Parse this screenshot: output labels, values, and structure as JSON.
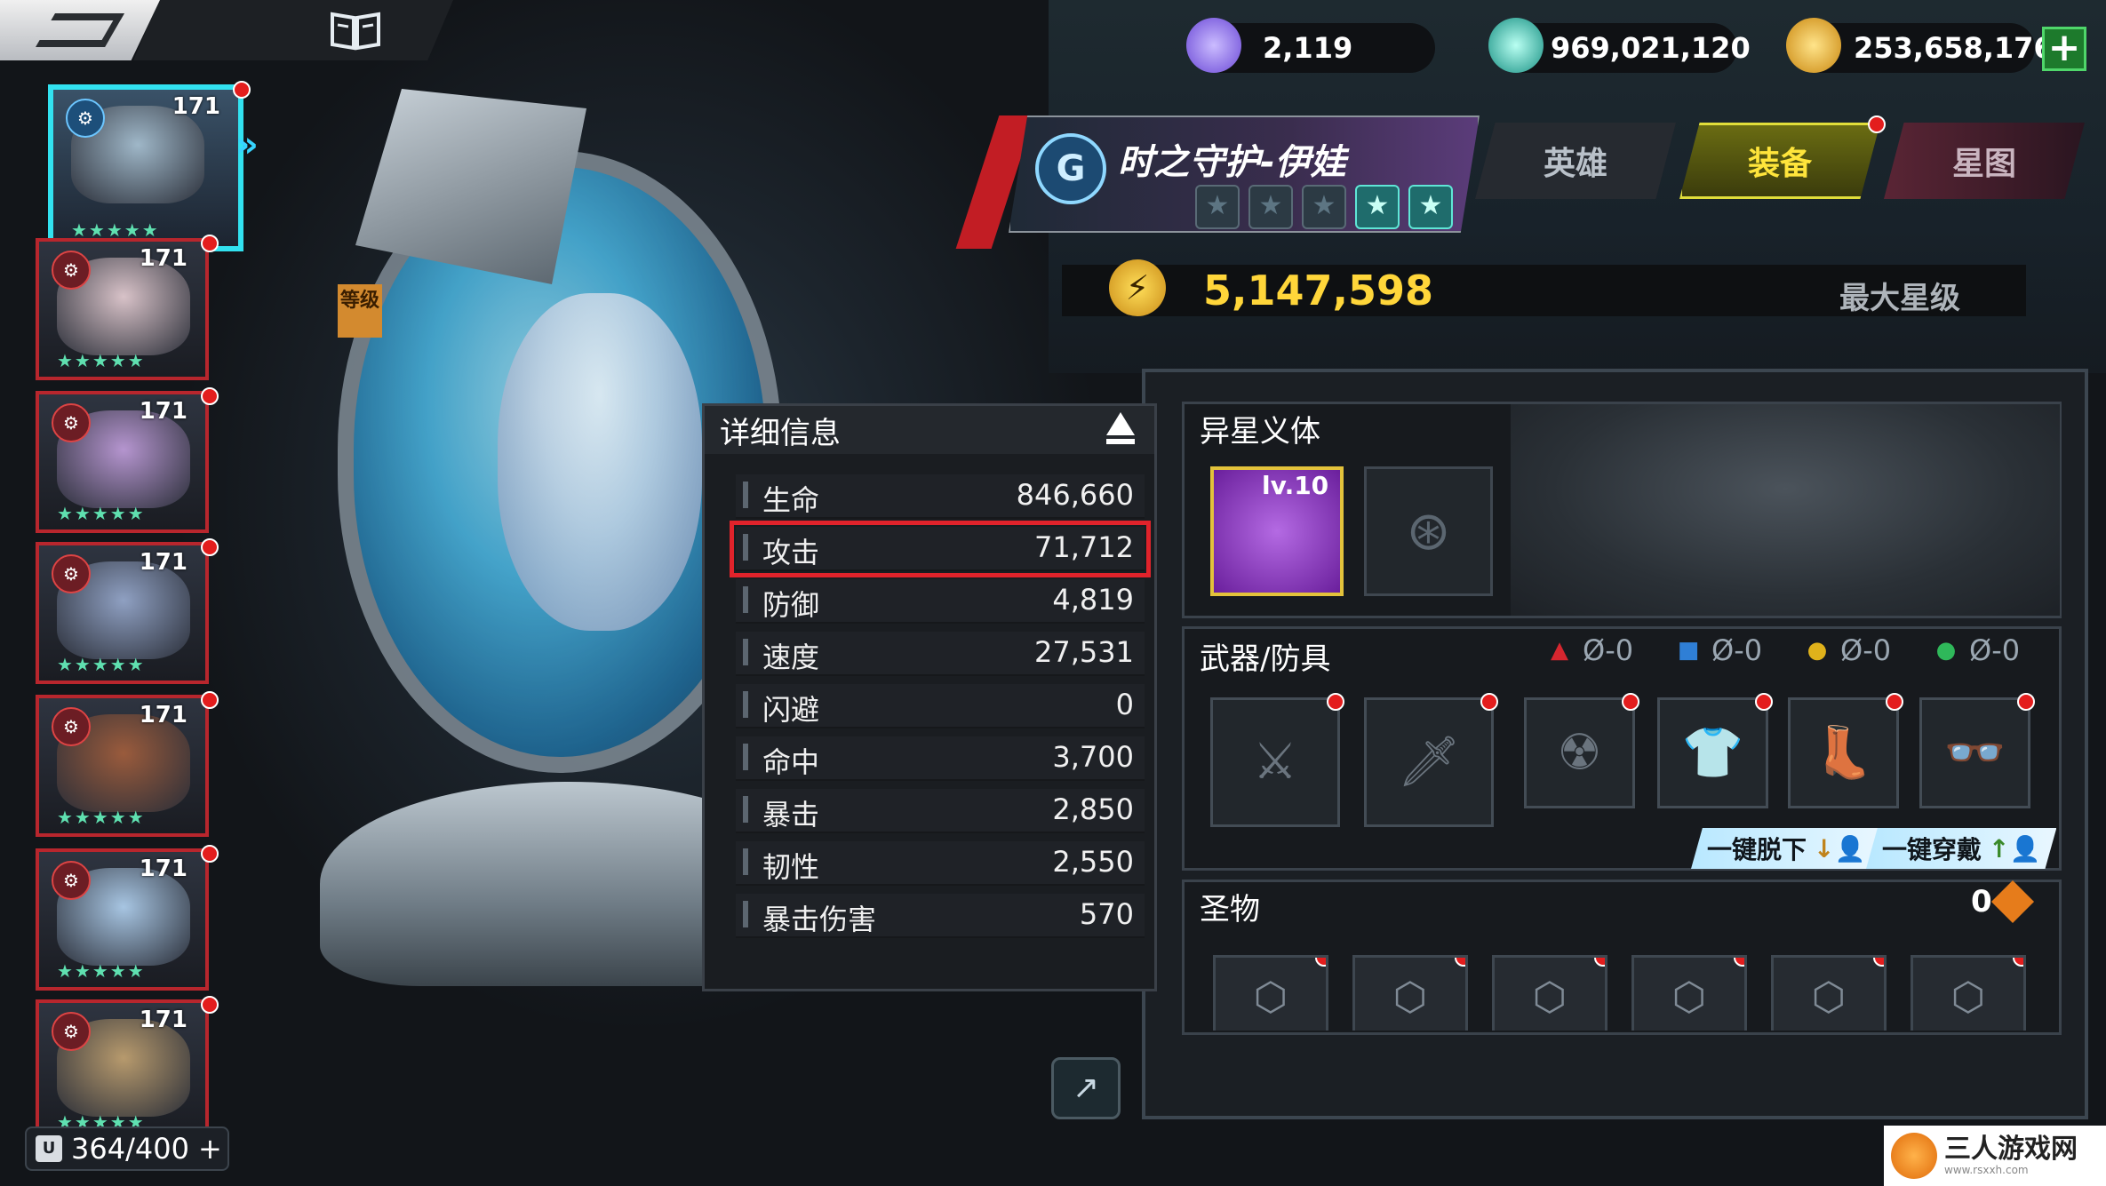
{
  "currency": [
    {
      "name": "gem",
      "value": "2,119",
      "color": "#7a5be0"
    },
    {
      "name": "credit",
      "value": "969,021,120",
      "color": "#1fb6a6"
    },
    {
      "name": "gold",
      "value": "253,658,176",
      "color": "#e3a21b"
    }
  ],
  "plus_label": "+",
  "hero": {
    "name": "时之守护-伊娃",
    "stars_total": 5,
    "stars_active": 2,
    "power": "5,147,598",
    "max_star_label": "最大星级"
  },
  "tabs": [
    {
      "label": "英雄",
      "active": false
    },
    {
      "label": "装备",
      "active": true
    },
    {
      "label": "星图",
      "active": false
    }
  ],
  "roster": {
    "heroes": [
      {
        "level": "171",
        "selected": true,
        "face_color": "#9fb7c8"
      },
      {
        "level": "171",
        "selected": false,
        "face_color": "#d8c2c8"
      },
      {
        "level": "171",
        "selected": false,
        "face_color": "#b595cf"
      },
      {
        "level": "171",
        "selected": false,
        "face_color": "#8fa0c2"
      },
      {
        "level": "171",
        "selected": false,
        "face_color": "#9a5b3c"
      },
      {
        "level": "171",
        "selected": false,
        "face_color": "#a7c5e2"
      },
      {
        "level": "171",
        "selected": false,
        "face_color": "#b79a6d"
      }
    ],
    "capacity": "364/400"
  },
  "bg_sign": "等级",
  "details": {
    "title": "详细信息",
    "stats": [
      {
        "label": "生命",
        "value": "846,660",
        "highlight": false
      },
      {
        "label": "攻击",
        "value": "71,712",
        "highlight": true
      },
      {
        "label": "防御",
        "value": "4,819",
        "highlight": false
      },
      {
        "label": "速度",
        "value": "27,531",
        "highlight": false
      },
      {
        "label": "闪避",
        "value": "0",
        "highlight": false
      },
      {
        "label": "命中",
        "value": "3,700",
        "highlight": false
      },
      {
        "label": "暴击",
        "value": "2,850",
        "highlight": false
      },
      {
        "label": "韧性",
        "value": "2,550",
        "highlight": false
      },
      {
        "label": "暴击伤害",
        "value": "570",
        "highlight": false
      }
    ]
  },
  "alien_body": {
    "title": "异星义体",
    "item_level": "lv.10"
  },
  "weapons": {
    "title": "武器/防具",
    "resources": [
      {
        "value": "Ø-0",
        "color": "#d6262f",
        "icon": "red-triangle-icon"
      },
      {
        "value": "Ø-0",
        "color": "#2f7fd6",
        "icon": "blue-square-icon"
      },
      {
        "value": "Ø-0",
        "color": "#e0b21b",
        "icon": "yellow-circle-icon"
      },
      {
        "value": "Ø-0",
        "color": "#2fb85a",
        "icon": "green-circle-icon"
      }
    ],
    "slots": [
      {
        "icon": "crossed-swords-icon",
        "glyph": "⚔"
      },
      {
        "icon": "knife-icon",
        "glyph": "🗡"
      },
      {
        "icon": "gas-mask-icon",
        "glyph": "☢"
      },
      {
        "icon": "shirt-icon",
        "glyph": "👕"
      },
      {
        "icon": "boot-icon",
        "glyph": "👢"
      },
      {
        "icon": "goggles-icon",
        "glyph": "👓"
      }
    ],
    "unequip_all": "一键脱下",
    "equip_all": "一键穿戴"
  },
  "relics": {
    "title": "圣物",
    "count": "0",
    "slots": 6
  },
  "watermark": {
    "text": "三人游戏网",
    "url": "www.rsxxh.com"
  }
}
